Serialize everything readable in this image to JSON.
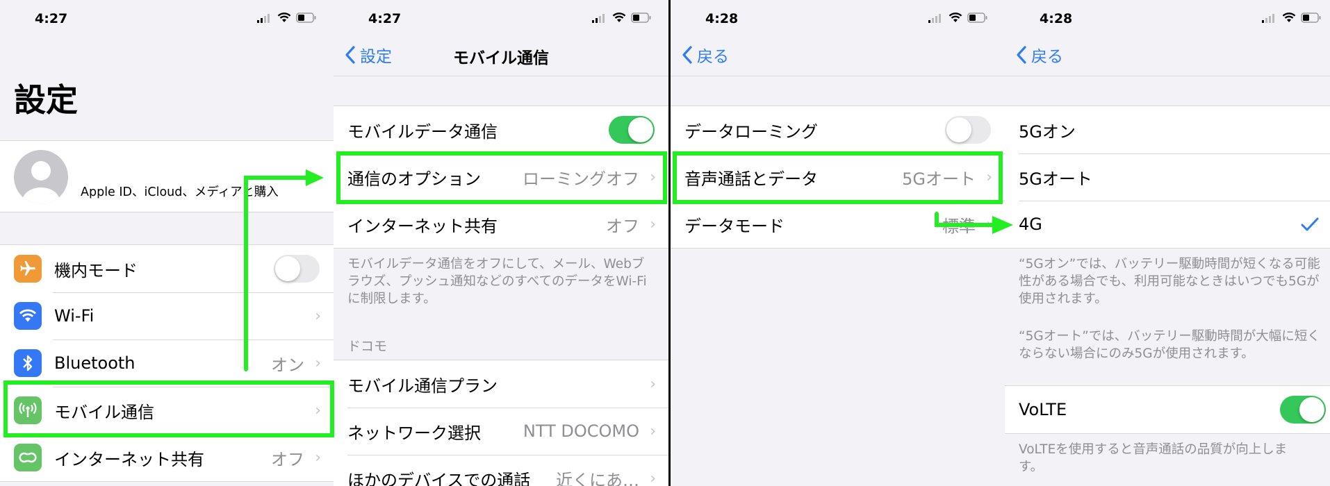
{
  "colors": {
    "accent": "#2f7cf6",
    "highlight": "#22ee22",
    "toggle_on": "#34c759"
  },
  "panel1": {
    "time": "4:27",
    "large_title": "設定",
    "profile_label": "Apple ID、iCloud、メディアと購入",
    "items": [
      {
        "label": "機内モード",
        "icon": "airplane-icon",
        "color": "#f09a37"
      },
      {
        "label": "Wi-Fi",
        "icon": "wifi-icon",
        "color": "#3478f6"
      },
      {
        "label": "Bluetooth",
        "value": "オン",
        "icon": "bluetooth-icon",
        "color": "#3478f6"
      },
      {
        "label": "モバイル通信",
        "icon": "antenna-icon",
        "color": "#65c466"
      },
      {
        "label": "インターネット共有",
        "value": "オフ",
        "icon": "hotspot-icon",
        "color": "#65c466"
      }
    ]
  },
  "panel2": {
    "time": "4:27",
    "back_label": "設定",
    "title": "モバイル通信",
    "rows": [
      {
        "label": "モバイルデータ通信"
      },
      {
        "label": "通信のオプション",
        "value": "ローミングオフ"
      },
      {
        "label": "インターネット共有",
        "value": "オフ"
      }
    ],
    "footnote": "モバイルデータ通信をオフにして、メール、Webブラウズ、プッシュ通知などのすべてのデータをWi-Fiに制限します。",
    "section_header": "ドコモ",
    "carrier_rows": [
      {
        "label": "モバイル通信プラン"
      },
      {
        "label": "ネットワーク選択",
        "value": "NTT DOCOMO"
      },
      {
        "label": "ほかのデバイスでの通話",
        "value": "近くにあ…"
      }
    ]
  },
  "panel3": {
    "time": "4:28",
    "back_label": "戻る",
    "rows": [
      {
        "label": "データローミング"
      },
      {
        "label": "音声通話とデータ",
        "value": "5Gオート"
      },
      {
        "label": "データモード",
        "value": "標準"
      }
    ]
  },
  "panel4": {
    "time": "4:28",
    "back_label": "戻る",
    "options": [
      {
        "label": "5Gオン"
      },
      {
        "label": "5Gオート"
      },
      {
        "label": "4G",
        "selected": true
      }
    ],
    "footnote1": "“5Gオン”では、バッテリー駆動時間が短くなる可能性がある場合でも、利用可能なときはいつでも5Gが使用されます。",
    "footnote2": "“5Gオート”では、バッテリー駆動時間が大幅に短くならない場合にのみ5Gが使用されます。",
    "volte_label": "VoLTE",
    "volte_footnote": "VoLTEを使用すると音声通話の品質が向上します。"
  }
}
